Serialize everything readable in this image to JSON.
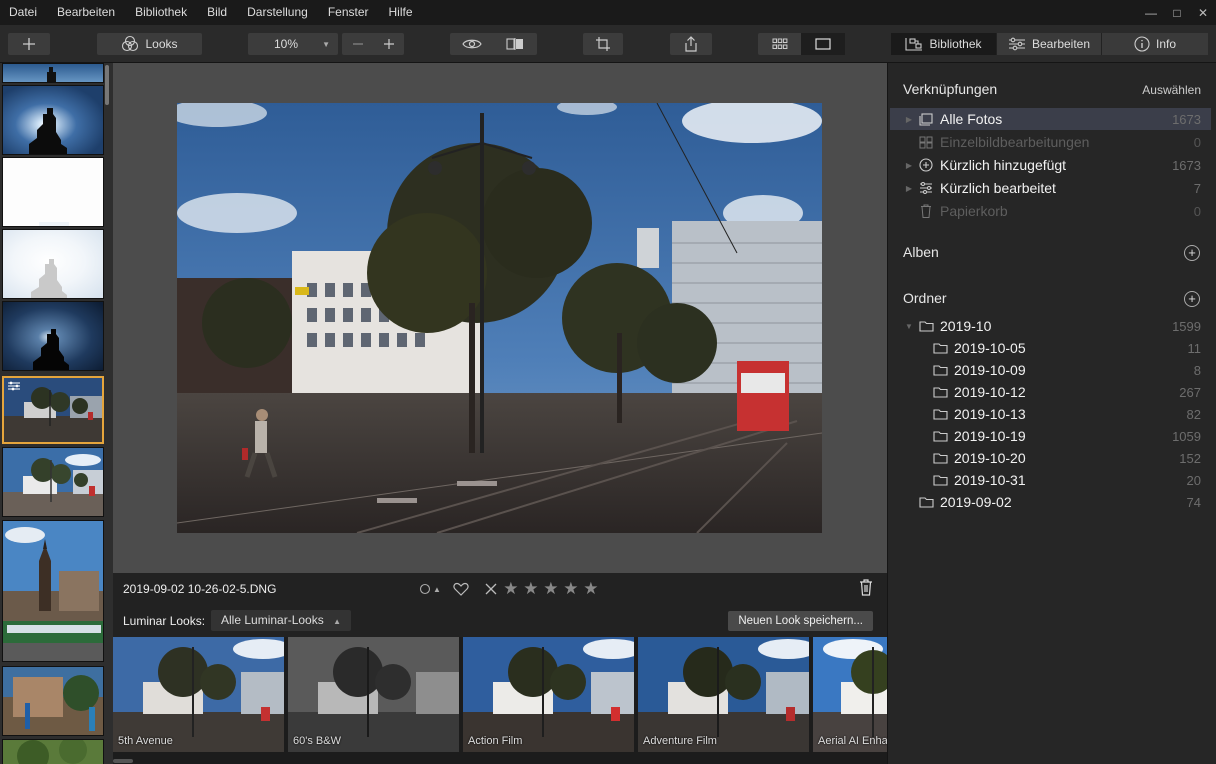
{
  "menubar": {
    "items": [
      "Datei",
      "Bearbeiten",
      "Bibliothek",
      "Bild",
      "Darstellung",
      "Fenster",
      "Hilfe"
    ]
  },
  "window_controls": [
    "—",
    "□",
    "✕"
  ],
  "toolbar": {
    "add_icon": "plus-icon",
    "looks_label": "Looks",
    "zoom_value": "10%",
    "zoom_out_icon": "minus-icon",
    "zoom_in_icon": "plus-icon",
    "tabs": {
      "library": "Bibliothek",
      "edit": "Bearbeiten",
      "info": "Info"
    }
  },
  "info_bar": {
    "filename": "2019-09-02 10-26-02-5.DNG",
    "rating_stars": 0,
    "stars": [
      "★",
      "★",
      "★",
      "★",
      "★"
    ]
  },
  "looks_bar": {
    "label": "Luminar Looks:",
    "selected_collection": "Alle Luminar-Looks",
    "save_button": "Neuen Look speichern..."
  },
  "looks": [
    {
      "name": "5th Avenue"
    },
    {
      "name": "60's B&W"
    },
    {
      "name": "Action Film"
    },
    {
      "name": "Adventure Film"
    },
    {
      "name": "Aerial AI Enhance"
    }
  ],
  "sidebar": {
    "shortcuts_title": "Verknüpfungen",
    "shortcuts_action": "Auswählen",
    "shortcuts": [
      {
        "label": "Alle Fotos",
        "count": "1673",
        "icon": "photos-icon",
        "selected": true
      },
      {
        "label": "Einzelbildbearbeitungen",
        "count": "0",
        "icon": "single-edits-icon",
        "dim": true
      },
      {
        "label": "Kürzlich hinzugefügt",
        "count": "1673",
        "icon": "recently-added-icon"
      },
      {
        "label": "Kürzlich bearbeitet",
        "count": "7",
        "icon": "recently-edited-icon"
      },
      {
        "label": "Papierkorb",
        "count": "0",
        "icon": "trash-icon",
        "dim": true
      }
    ],
    "albums_title": "Alben",
    "folders_title": "Ordner",
    "folders": [
      {
        "label": "2019-10",
        "count": "1599",
        "level": 0,
        "expanded": true
      },
      {
        "label": "2019-10-05",
        "count": "11",
        "level": 1
      },
      {
        "label": "2019-10-09",
        "count": "8",
        "level": 1
      },
      {
        "label": "2019-10-12",
        "count": "267",
        "level": 1
      },
      {
        "label": "2019-10-13",
        "count": "82",
        "level": 1
      },
      {
        "label": "2019-10-19",
        "count": "1059",
        "level": 1
      },
      {
        "label": "2019-10-20",
        "count": "152",
        "level": 1
      },
      {
        "label": "2019-10-31",
        "count": "20",
        "level": 1
      },
      {
        "label": "2019-09-02",
        "count": "74",
        "level": 0
      }
    ]
  },
  "colors": {
    "accent_selection": "#e5a53c",
    "selected_row": "#3b3e4a"
  }
}
